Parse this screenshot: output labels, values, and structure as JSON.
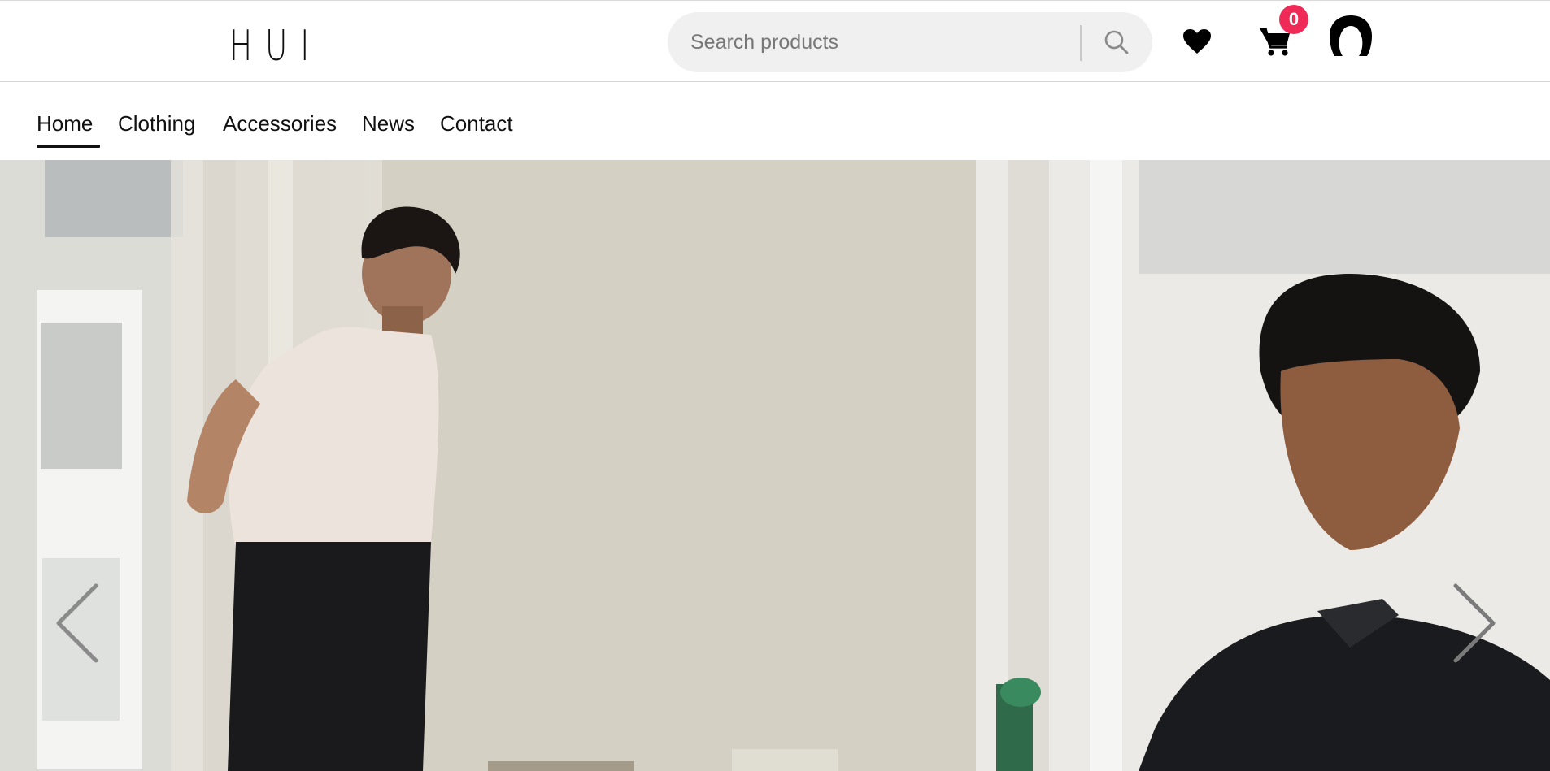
{
  "header": {
    "logo_text": "HUI",
    "search": {
      "placeholder": "Search products",
      "value": ""
    },
    "cart_count": "0",
    "accent_color": "#f02a57"
  },
  "nav": {
    "items": [
      {
        "label": "Home",
        "active": true
      },
      {
        "label": "Clothing",
        "active": false
      },
      {
        "label": "Accessories",
        "active": false
      },
      {
        "label": "News",
        "active": false
      },
      {
        "label": "Contact",
        "active": false
      }
    ]
  },
  "icons": {
    "search": "search-icon",
    "wishlist": "heart-icon",
    "cart": "cart-icon",
    "account": "user-icon",
    "prev": "chevron-left-icon",
    "next": "chevron-right-icon"
  }
}
